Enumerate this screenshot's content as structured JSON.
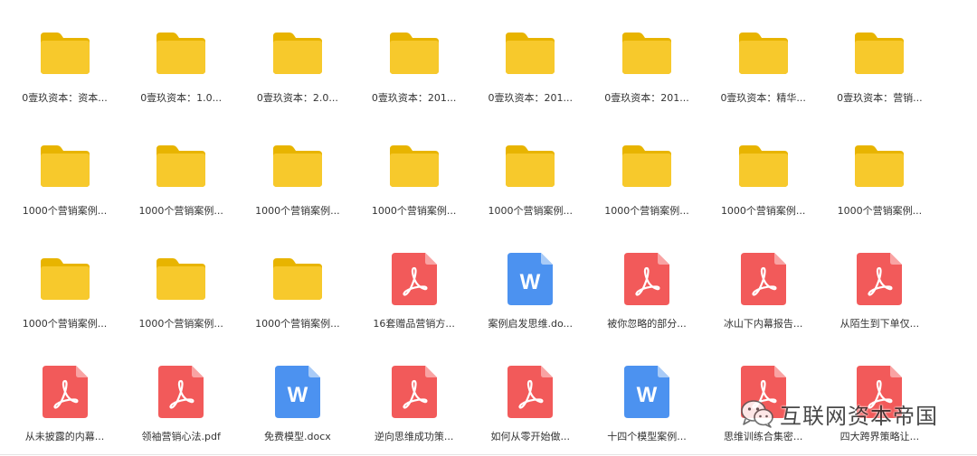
{
  "colors": {
    "folder_back": "#e8b400",
    "folder_front": "#f7c92c",
    "pdf": "#f25a5a",
    "pdf_fold": "#f9a3a3",
    "word": "#4c92f0",
    "word_fold": "#a9cbf7"
  },
  "files": [
    {
      "type": "folder",
      "label": "0壹玖资本：资本..."
    },
    {
      "type": "folder",
      "label": "0壹玖资本：1.0..."
    },
    {
      "type": "folder",
      "label": "0壹玖资本：2.0..."
    },
    {
      "type": "folder",
      "label": "0壹玖资本：201..."
    },
    {
      "type": "folder",
      "label": "0壹玖资本：201..."
    },
    {
      "type": "folder",
      "label": "0壹玖资本：201..."
    },
    {
      "type": "folder",
      "label": "0壹玖资本：精华..."
    },
    {
      "type": "folder",
      "label": "0壹玖资本：营销..."
    },
    {
      "type": "folder",
      "label": "1000个营销案例..."
    },
    {
      "type": "folder",
      "label": "1000个营销案例..."
    },
    {
      "type": "folder",
      "label": "1000个营销案例..."
    },
    {
      "type": "folder",
      "label": "1000个营销案例..."
    },
    {
      "type": "folder",
      "label": "1000个营销案例..."
    },
    {
      "type": "folder",
      "label": "1000个营销案例..."
    },
    {
      "type": "folder",
      "label": "1000个营销案例..."
    },
    {
      "type": "folder",
      "label": "1000个营销案例..."
    },
    {
      "type": "folder",
      "label": "1000个营销案例..."
    },
    {
      "type": "folder",
      "label": "1000个营销案例..."
    },
    {
      "type": "folder",
      "label": "1000个营销案例..."
    },
    {
      "type": "pdf",
      "label": "16套赠品营销方..."
    },
    {
      "type": "word",
      "label": "案例启发思维.do..."
    },
    {
      "type": "pdf",
      "label": "被你忽略的部分..."
    },
    {
      "type": "pdf",
      "label": "冰山下内幕报告..."
    },
    {
      "type": "pdf",
      "label": "从陌生到下单仅..."
    },
    {
      "type": "pdf",
      "label": "从未披露的内幕..."
    },
    {
      "type": "pdf",
      "label": "领袖营销心法.pdf"
    },
    {
      "type": "word",
      "label": "免费模型.docx"
    },
    {
      "type": "pdf",
      "label": "逆向思维成功策..."
    },
    {
      "type": "pdf",
      "label": "如何从零开始做..."
    },
    {
      "type": "word",
      "label": "十四个模型案例..."
    },
    {
      "type": "pdf",
      "label": "思维训练合集密..."
    },
    {
      "type": "pdf",
      "label": "四大跨界策略让..."
    }
  ],
  "watermark": {
    "icon": "wechat-icon",
    "text": "互联网资本帝国"
  }
}
